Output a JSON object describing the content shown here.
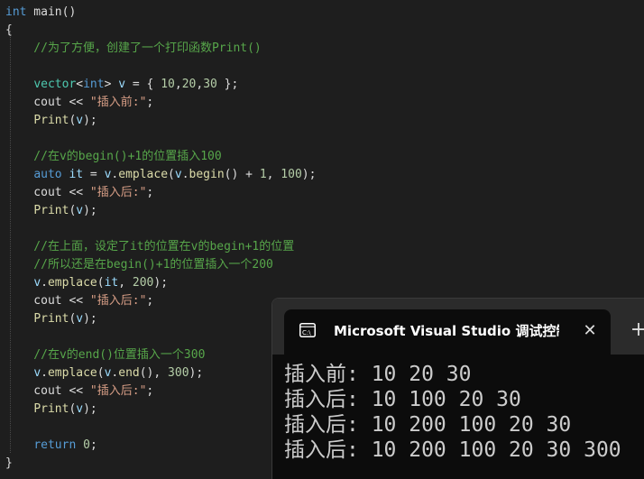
{
  "editor": {
    "lines": [
      [
        [
          "kw",
          "int"
        ],
        [
          "pl",
          " main()"
        ]
      ],
      [
        [
          "pl",
          "{"
        ]
      ],
      [
        [
          "cm",
          "    //为了方便，创建了一个打印函数Print()"
        ]
      ],
      [],
      [
        [
          "pl",
          "    "
        ],
        [
          "ty",
          "vector"
        ],
        [
          "pl",
          "<"
        ],
        [
          "kw",
          "int"
        ],
        [
          "pl",
          "> "
        ],
        [
          "var",
          "v"
        ],
        [
          "pl",
          " = { "
        ],
        [
          "num",
          "10"
        ],
        [
          "pl",
          ","
        ],
        [
          "num",
          "20"
        ],
        [
          "pl",
          ","
        ],
        [
          "num",
          "30"
        ],
        [
          "pl",
          " };"
        ]
      ],
      [
        [
          "pl",
          "    cout << "
        ],
        [
          "str",
          "\"插入前:\""
        ],
        [
          "pl",
          ";"
        ]
      ],
      [
        [
          "pl",
          "    "
        ],
        [
          "fn",
          "Print"
        ],
        [
          "pl",
          "("
        ],
        [
          "var",
          "v"
        ],
        [
          "pl",
          ");"
        ]
      ],
      [],
      [
        [
          "cm",
          "    //在v的begin()+1的位置插入100"
        ]
      ],
      [
        [
          "pl",
          "    "
        ],
        [
          "kw",
          "auto"
        ],
        [
          "pl",
          " "
        ],
        [
          "var",
          "it"
        ],
        [
          "pl",
          " = "
        ],
        [
          "var",
          "v"
        ],
        [
          "pl",
          "."
        ],
        [
          "fn",
          "emplace"
        ],
        [
          "pl",
          "("
        ],
        [
          "var",
          "v"
        ],
        [
          "pl",
          "."
        ],
        [
          "fn",
          "begin"
        ],
        [
          "pl",
          "() + "
        ],
        [
          "num",
          "1"
        ],
        [
          "pl",
          ", "
        ],
        [
          "num",
          "100"
        ],
        [
          "pl",
          ");"
        ]
      ],
      [
        [
          "pl",
          "    cout << "
        ],
        [
          "str",
          "\"插入后:\""
        ],
        [
          "pl",
          ";"
        ]
      ],
      [
        [
          "pl",
          "    "
        ],
        [
          "fn",
          "Print"
        ],
        [
          "pl",
          "("
        ],
        [
          "var",
          "v"
        ],
        [
          "pl",
          ");"
        ]
      ],
      [],
      [
        [
          "cm",
          "    //在上面，设定了it的位置在v的begin+1的位置"
        ]
      ],
      [
        [
          "cm",
          "    //所以还是在begin()+1的位置插入一个200"
        ]
      ],
      [
        [
          "pl",
          "    "
        ],
        [
          "var",
          "v"
        ],
        [
          "pl",
          "."
        ],
        [
          "fn",
          "emplace"
        ],
        [
          "pl",
          "("
        ],
        [
          "var",
          "it"
        ],
        [
          "pl",
          ", "
        ],
        [
          "num",
          "200"
        ],
        [
          "pl",
          ");"
        ]
      ],
      [
        [
          "pl",
          "    cout << "
        ],
        [
          "str",
          "\"插入后:\""
        ],
        [
          "pl",
          ";"
        ]
      ],
      [
        [
          "pl",
          "    "
        ],
        [
          "fn",
          "Print"
        ],
        [
          "pl",
          "("
        ],
        [
          "var",
          "v"
        ],
        [
          "pl",
          ");"
        ]
      ],
      [],
      [
        [
          "cm",
          "    //在v的end()位置插入一个300"
        ]
      ],
      [
        [
          "pl",
          "    "
        ],
        [
          "var",
          "v"
        ],
        [
          "pl",
          "."
        ],
        [
          "fn",
          "emplace"
        ],
        [
          "pl",
          "("
        ],
        [
          "var",
          "v"
        ],
        [
          "pl",
          "."
        ],
        [
          "fn",
          "end"
        ],
        [
          "pl",
          "(), "
        ],
        [
          "num",
          "300"
        ],
        [
          "pl",
          ");"
        ]
      ],
      [
        [
          "pl",
          "    cout << "
        ],
        [
          "str",
          "\"插入后:\""
        ],
        [
          "pl",
          ";"
        ]
      ],
      [
        [
          "pl",
          "    "
        ],
        [
          "fn",
          "Print"
        ],
        [
          "pl",
          "("
        ],
        [
          "var",
          "v"
        ],
        [
          "pl",
          ");"
        ]
      ],
      [],
      [
        [
          "pl",
          "    "
        ],
        [
          "kw",
          "return"
        ],
        [
          "pl",
          " "
        ],
        [
          "num",
          "0"
        ],
        [
          "pl",
          ";"
        ]
      ],
      [
        [
          "pl",
          "}"
        ]
      ]
    ]
  },
  "terminal": {
    "tab_icon": "console-icon",
    "tab_title": "Microsoft Visual Studio 调试控制台",
    "close_glyph": "✕",
    "new_tab_glyph": "+",
    "output": [
      "插入前: 10 20 30",
      "插入后: 10 100 20 30",
      "插入后: 10 200 100 20 30",
      "插入后: 10 200 100 20 30 300"
    ]
  },
  "colors": {
    "editor_bg": "#1e1e1e",
    "keyword": "#569cd6",
    "function": "#dcdcaa",
    "string": "#d69d85",
    "number": "#b5cea8",
    "comment": "#57a64a",
    "type": "#4ec9b0",
    "variable": "#9cdcfe",
    "terminal_bg": "#0c0c0c",
    "terminal_titlebar": "#2b2b2b"
  }
}
